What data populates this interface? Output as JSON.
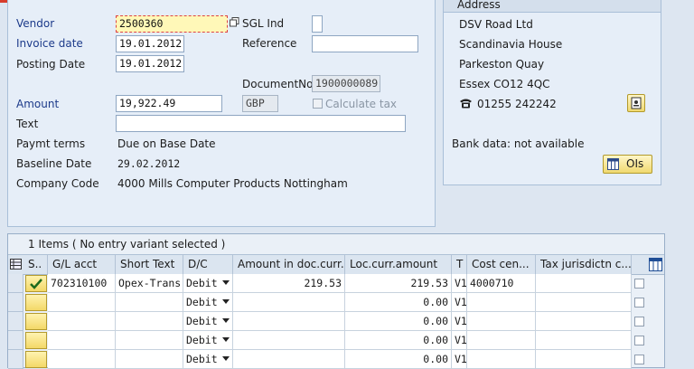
{
  "header": {
    "vendor_label": "Vendor",
    "vendor_value": "2500360",
    "sgl_label": "SGL Ind",
    "invoice_date_label": "Invoice date",
    "invoice_date_value": "19.01.2012",
    "reference_label": "Reference",
    "reference_value": "",
    "posting_date_label": "Posting Date",
    "posting_date_value": "19.01.2012",
    "document_no_label": "DocumentNo",
    "document_no_value": "1900000089",
    "amount_label": "Amount",
    "amount_value": "19,922.49",
    "currency_value": "GBP",
    "calculate_tax_label": "Calculate tax",
    "text_label": "Text",
    "text_value": "",
    "payment_terms_label": "Paymt terms",
    "payment_terms_value": "Due on Base Date",
    "baseline_date_label": "Baseline Date",
    "baseline_date_value": "29.02.2012",
    "company_code_label": "Company Code",
    "company_code_value": "4000 Mills Computer Products Nottingham"
  },
  "address": {
    "title": "Address",
    "line1": "DSV Road Ltd",
    "line2": "Scandinavia House",
    "line3": "Parkeston Quay",
    "line4": "Essex CO12 4QC",
    "phone": "01255 242242",
    "bank_data": "Bank data: not available",
    "ois_button": "OIs"
  },
  "items_table": {
    "title": "1 Items ( No entry variant selected )",
    "columns": [
      "S..",
      "G/L acct",
      "Short Text",
      "D/C",
      "Amount in doc.curr.",
      "Loc.curr.amount",
      "T",
      "Cost cen...",
      "Tax jurisdictn c..."
    ],
    "rows": [
      {
        "gl_acct": "702310100",
        "short_text": "Opex-Trans...",
        "dc": "Debit",
        "amount_doc": "219.53",
        "amount_loc": "219.53",
        "tax": "V1",
        "cost_center": "4000710",
        "tax_jur": ""
      },
      {
        "gl_acct": "",
        "short_text": "",
        "dc": "Debit",
        "amount_doc": "",
        "amount_loc": "0.00",
        "tax": "V1",
        "cost_center": "",
        "tax_jur": ""
      },
      {
        "gl_acct": "",
        "short_text": "",
        "dc": "Debit",
        "amount_doc": "",
        "amount_loc": "0.00",
        "tax": "V1",
        "cost_center": "",
        "tax_jur": ""
      },
      {
        "gl_acct": "",
        "short_text": "",
        "dc": "Debit",
        "amount_doc": "",
        "amount_loc": "0.00",
        "tax": "V1",
        "cost_center": "",
        "tax_jur": ""
      },
      {
        "gl_acct": "",
        "short_text": "",
        "dc": "Debit",
        "amount_doc": "",
        "amount_loc": "0.00",
        "tax": "V1",
        "cost_center": "",
        "tax_jur": ""
      }
    ]
  },
  "colors": {
    "background": "#dde6f1",
    "panel": "#e6eef8",
    "required_field": "#fff8b8",
    "status_button": "#f3d868",
    "accent_red": "#d73c2c"
  }
}
